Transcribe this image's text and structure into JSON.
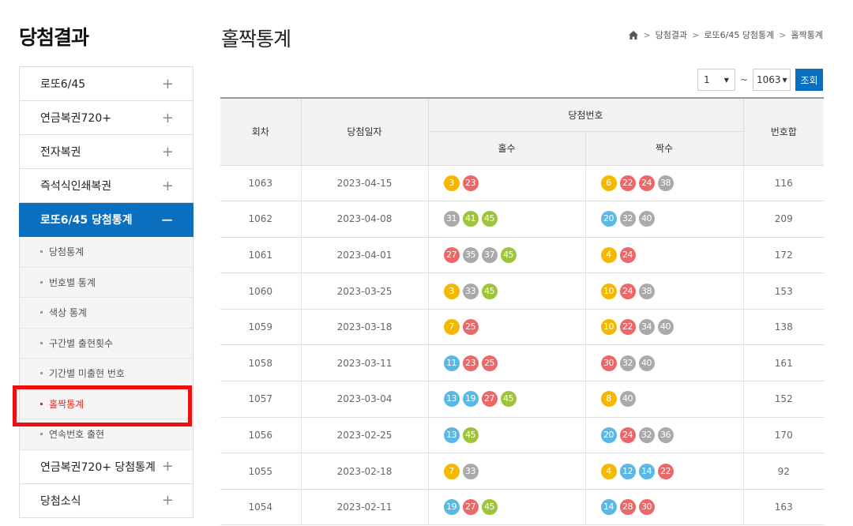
{
  "sidebar": {
    "title": "당첨결과",
    "items": [
      {
        "label": "로또6/45",
        "icon": "+"
      },
      {
        "label": "연금복권720+",
        "icon": "+"
      },
      {
        "label": "전자복권",
        "icon": "+"
      },
      {
        "label": "즉석식인쇄복권",
        "icon": "+"
      },
      {
        "label": "로또6/45 당첨통계",
        "icon": "−"
      }
    ],
    "sub_items": [
      {
        "label": "당첨통계"
      },
      {
        "label": "번호별 통계"
      },
      {
        "label": "색상 통계"
      },
      {
        "label": "구간별 출현횟수"
      },
      {
        "label": "기간별 미출현 번호"
      },
      {
        "label": "홀짝통계"
      },
      {
        "label": "연속번호 출현"
      }
    ],
    "items_after": [
      {
        "label": "연금복권720+ 당첨통계",
        "icon": "+"
      },
      {
        "label": "당첨소식",
        "icon": "+"
      }
    ]
  },
  "header": {
    "title": "홀짝통계",
    "breadcrumb": [
      "당첨결과",
      "로또6/45 당첨통계",
      "홀짝통계"
    ]
  },
  "filter": {
    "from": "1",
    "tilde": "~",
    "to": "1063",
    "search_label": "조회"
  },
  "table": {
    "headers": {
      "round": "회차",
      "date": "당첨일자",
      "numbers": "당첨번호",
      "odd": "홀수",
      "even": "짝수",
      "sum": "번호합"
    },
    "rows": [
      {
        "round": "1063",
        "date": "2023-04-15",
        "odd": [
          3,
          23
        ],
        "even": [
          6,
          22,
          24,
          38
        ],
        "sum": "116"
      },
      {
        "round": "1062",
        "date": "2023-04-08",
        "odd": [
          31,
          41,
          45
        ],
        "even": [
          20,
          32,
          40
        ],
        "sum": "209"
      },
      {
        "round": "1061",
        "date": "2023-04-01",
        "odd": [
          27,
          35,
          37,
          45
        ],
        "even": [
          4,
          24
        ],
        "sum": "172"
      },
      {
        "round": "1060",
        "date": "2023-03-25",
        "odd": [
          3,
          33,
          45
        ],
        "even": [
          10,
          24,
          38
        ],
        "sum": "153"
      },
      {
        "round": "1059",
        "date": "2023-03-18",
        "odd": [
          7,
          25
        ],
        "even": [
          10,
          22,
          34,
          40
        ],
        "sum": "138"
      },
      {
        "round": "1058",
        "date": "2023-03-11",
        "odd": [
          11,
          23,
          25
        ],
        "even": [
          30,
          32,
          40
        ],
        "sum": "161"
      },
      {
        "round": "1057",
        "date": "2023-03-04",
        "odd": [
          13,
          19,
          27,
          45
        ],
        "even": [
          8,
          40
        ],
        "sum": "152"
      },
      {
        "round": "1056",
        "date": "2023-02-25",
        "odd": [
          13,
          45
        ],
        "even": [
          20,
          24,
          32,
          36
        ],
        "sum": "170"
      },
      {
        "round": "1055",
        "date": "2023-02-18",
        "odd": [
          7,
          33
        ],
        "even": [
          4,
          12,
          14,
          22
        ],
        "sum": "92"
      },
      {
        "round": "1054",
        "date": "2023-02-11",
        "odd": [
          19,
          27,
          45
        ],
        "even": [
          14,
          28,
          30
        ],
        "sum": "163"
      }
    ]
  },
  "ball_colors": {
    "1-10": "#f5b800",
    "11-20": "#5ab8e6",
    "21-30": "#ec6767",
    "31-40": "#aaaaaa",
    "41-45": "#9dc43a"
  }
}
